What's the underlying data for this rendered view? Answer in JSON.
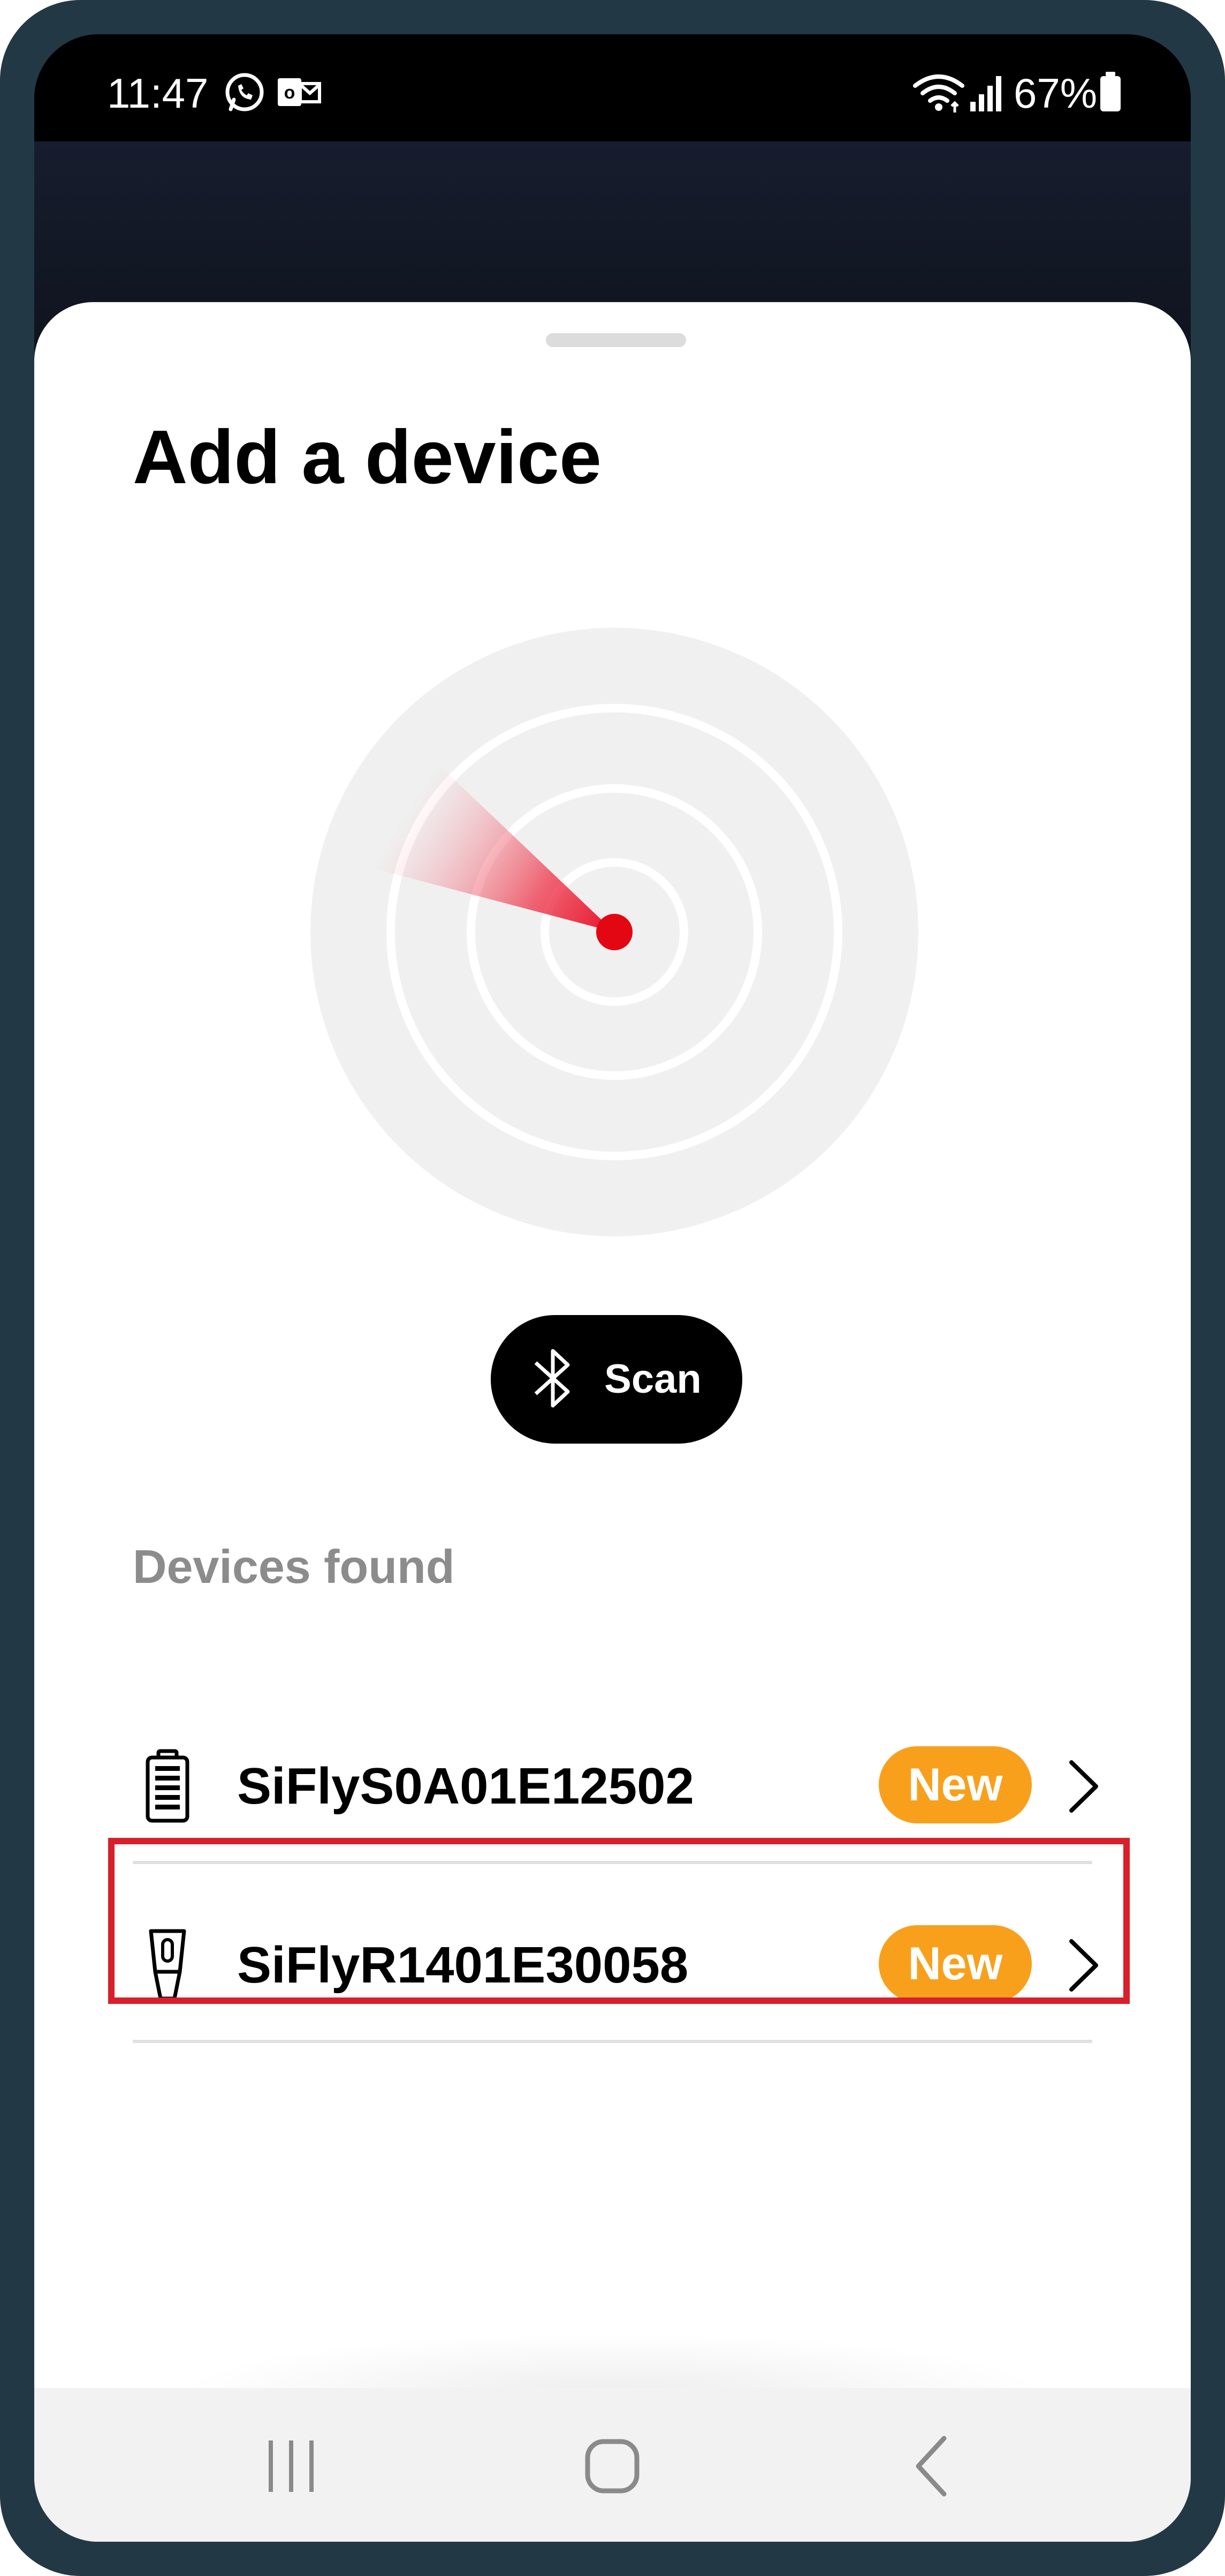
{
  "status_bar": {
    "time": "11:47",
    "battery_percent": "67%",
    "icons": [
      "whatsapp-icon",
      "outlook-icon",
      "wifi-icon",
      "signal-icon",
      "battery-icon"
    ]
  },
  "sheet": {
    "title": "Add a device"
  },
  "scan_button": {
    "label": "Scan",
    "icon": "bluetooth-icon"
  },
  "devices": {
    "section_label": "Devices found",
    "items": [
      {
        "name": "SiFlyS0A01E12502",
        "badge": "New",
        "icon": "battery-device-icon"
      },
      {
        "name": "SiFlyR1401E30058",
        "badge": "New",
        "icon": "remote-device-icon",
        "highlighted": true
      }
    ]
  },
  "nav_bar": {
    "buttons": [
      "recent-apps",
      "home",
      "back"
    ]
  },
  "colors": {
    "frame": "#233845",
    "badge": "#f8a01c",
    "radar_dot": "#e30613",
    "highlight": "#d81f2b",
    "section_label": "#8c8c8c"
  }
}
